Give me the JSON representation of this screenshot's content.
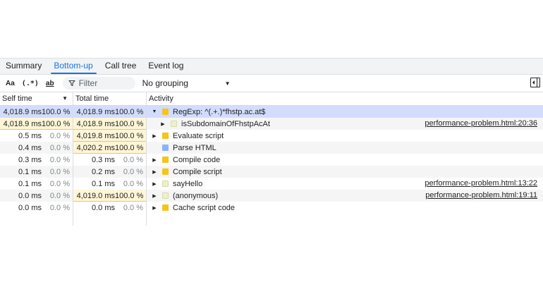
{
  "tabs": [
    {
      "label": "Summary",
      "active": false
    },
    {
      "label": "Bottom-up",
      "active": true
    },
    {
      "label": "Call tree",
      "active": false
    },
    {
      "label": "Event log",
      "active": false
    }
  ],
  "toolbar": {
    "match_case": "Aa",
    "regex": "(.*)",
    "whole_word": "ab",
    "filter_placeholder": "Filter",
    "grouping": "No grouping"
  },
  "columns": {
    "self_time": "Self time",
    "total_time": "Total time",
    "activity": "Activity"
  },
  "rows": [
    {
      "self_ms": "4,018.9 ms",
      "self_pct": "100.0 %",
      "total_ms": "4,018.9 ms",
      "total_pct": "100.0 %",
      "expand": "▼",
      "indent": 0,
      "color": "#f5c518",
      "name": "RegExp: ^(.+.)*fhstp.ac.at$",
      "link": "",
      "selected": true,
      "self_hl": true,
      "total_hl": true
    },
    {
      "self_ms": "4,018.9 ms",
      "self_pct": "100.0 %",
      "total_ms": "4,018.9 ms",
      "total_pct": "100.0 %",
      "expand": "▶",
      "indent": 1,
      "color": "#eef0c8",
      "name": "isSubdomainOfFhstpAcAt",
      "link": "performance-problem.html:20:36",
      "selected": false,
      "self_hl": true,
      "total_hl": true
    },
    {
      "self_ms": "0.5 ms",
      "self_pct": "0.0 %",
      "total_ms": "4,019.8 ms",
      "total_pct": "100.0 %",
      "expand": "▶",
      "indent": 0,
      "color": "#f5c518",
      "name": "Evaluate script",
      "link": "",
      "selected": false,
      "self_hl": false,
      "total_hl": true
    },
    {
      "self_ms": "0.4 ms",
      "self_pct": "0.0 %",
      "total_ms": "4,020.2 ms",
      "total_pct": "100.0 %",
      "expand": "",
      "indent": 0,
      "color": "#8ab4f8",
      "name": "Parse HTML",
      "link": "",
      "selected": false,
      "self_hl": false,
      "total_hl": true
    },
    {
      "self_ms": "0.3 ms",
      "self_pct": "0.0 %",
      "total_ms": "0.3 ms",
      "total_pct": "0.0 %",
      "expand": "▶",
      "indent": 0,
      "color": "#f5c518",
      "name": "Compile code",
      "link": "",
      "selected": false,
      "self_hl": false,
      "total_hl": false
    },
    {
      "self_ms": "0.1 ms",
      "self_pct": "0.0 %",
      "total_ms": "0.2 ms",
      "total_pct": "0.0 %",
      "expand": "▶",
      "indent": 0,
      "color": "#f5c518",
      "name": "Compile script",
      "link": "",
      "selected": false,
      "self_hl": false,
      "total_hl": false
    },
    {
      "self_ms": "0.1 ms",
      "self_pct": "0.0 %",
      "total_ms": "0.1 ms",
      "total_pct": "0.0 %",
      "expand": "▶",
      "indent": 0,
      "color": "#eef0c8",
      "name": "sayHello",
      "link": "performance-problem.html:13:22",
      "selected": false,
      "self_hl": false,
      "total_hl": false
    },
    {
      "self_ms": "0.0 ms",
      "self_pct": "0.0 %",
      "total_ms": "4,019.0 ms",
      "total_pct": "100.0 %",
      "expand": "▶",
      "indent": 0,
      "color": "#eef0c8",
      "name": "(anonymous)",
      "link": "performance-problem.html:19:11",
      "selected": false,
      "self_hl": false,
      "total_hl": true
    },
    {
      "self_ms": "0.0 ms",
      "self_pct": "0.0 %",
      "total_ms": "0.0 ms",
      "total_pct": "0.0 %",
      "expand": "▶",
      "indent": 0,
      "color": "#f5c518",
      "name": "Cache script code",
      "link": "",
      "selected": false,
      "self_hl": false,
      "total_hl": false
    }
  ]
}
